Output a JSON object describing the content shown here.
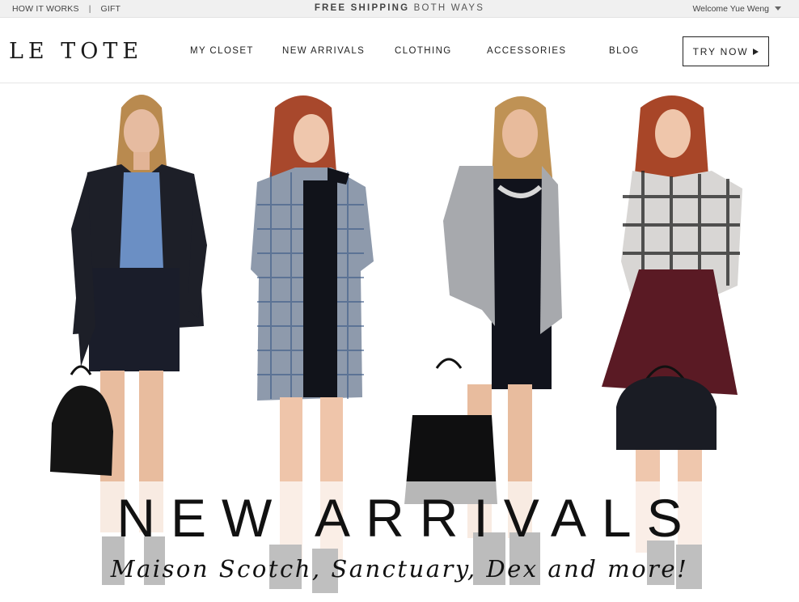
{
  "topbar": {
    "how_it_works": "HOW IT WORKS",
    "separator": "|",
    "gift": "GIFT",
    "shipping_bold": "FREE SHIPPING",
    "shipping_rest": "BOTH WAYS",
    "welcome": "Welcome Yue Weng"
  },
  "header": {
    "logo": "LE TOTE",
    "nav": [
      "MY CLOSET",
      "NEW ARRIVALS",
      "CLOTHING",
      "ACCESSORIES",
      "BLOG"
    ],
    "try_now": "TRY NOW"
  },
  "hero": {
    "title": "NEW ARRIVALS",
    "subtitle": "Maison Scotch, Sanctuary, Dex and more!"
  },
  "icons": {
    "dropdown": "caret-down-icon",
    "try_now": "play-triangle-icon"
  },
  "colors": {
    "topbar_bg": "#f0f0f0",
    "text": "#222222",
    "skirt_burgundy": "#5a1a24",
    "top_blue": "#6b8fc4"
  }
}
